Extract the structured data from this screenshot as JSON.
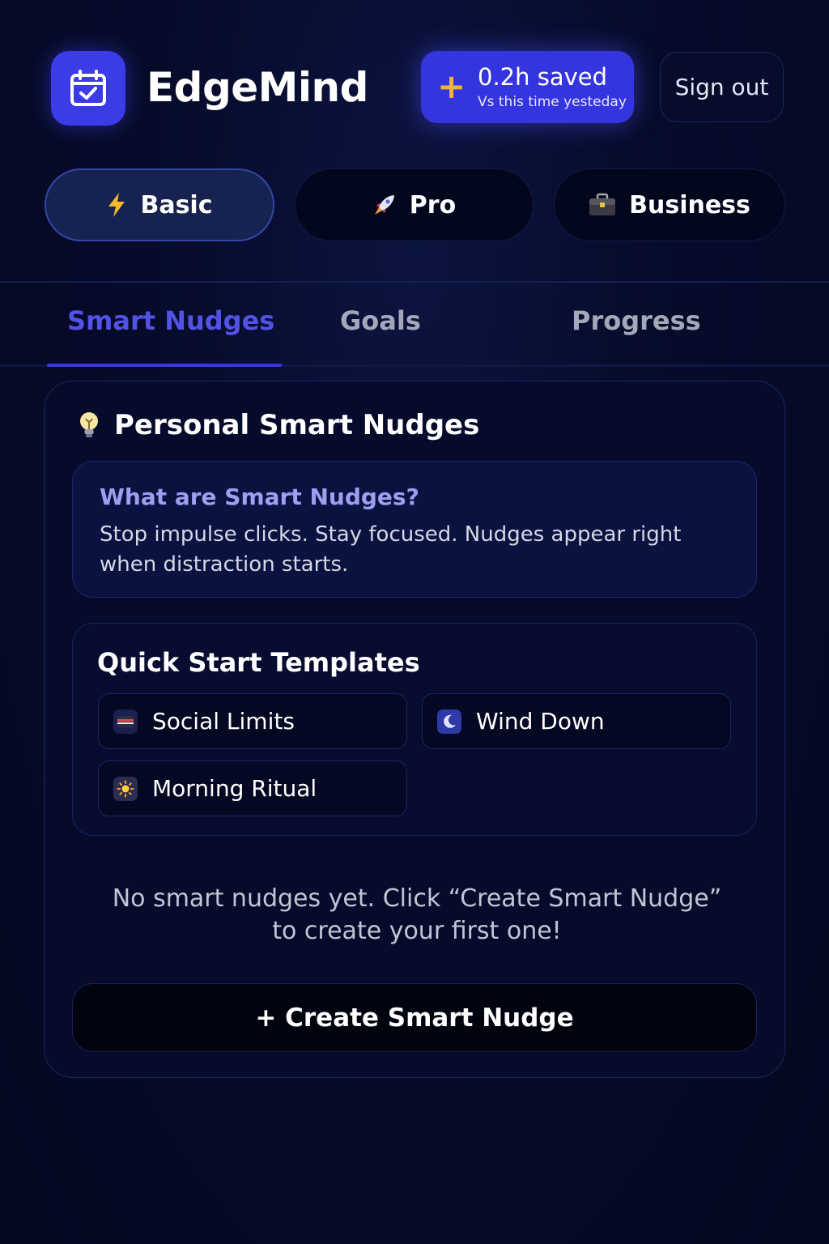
{
  "header": {
    "app_name": "EdgeMind",
    "saved_badge": {
      "icon": "plus-icon",
      "value": "0.2h saved",
      "subtitle": "Vs this time yesteday",
      "accent": "#f0b43a"
    },
    "sign_out_label": "Sign out"
  },
  "plans": [
    {
      "label": "Basic",
      "icon": "lightning-icon",
      "active": true
    },
    {
      "label": "Pro",
      "icon": "rocket-icon",
      "active": false
    },
    {
      "label": "Business",
      "icon": "briefcase-icon",
      "active": false
    }
  ],
  "tabs": [
    {
      "label": "Smart Nudges",
      "active": true
    },
    {
      "label": "Goals",
      "active": false
    },
    {
      "label": "Progress",
      "active": false
    }
  ],
  "main": {
    "section_title": "Personal Smart Nudges",
    "section_icon": "lightbulb-icon",
    "info": {
      "title": "What are Smart Nudges?",
      "text": "Stop impulse clicks. Stay focused. Nudges appear right when distraction starts."
    },
    "templates": {
      "title": "Quick Start Templates",
      "items": [
        {
          "label": "Social Limits",
          "icon": "phone-icon"
        },
        {
          "label": "Wind Down",
          "icon": "moon-icon"
        },
        {
          "label": "Morning Ritual",
          "icon": "sun-icon"
        }
      ]
    },
    "empty_message": "No smart nudges yet. Click “Create Smart Nudge” to create your first one!",
    "create_button_label": "+ Create Smart Nudge"
  },
  "colors": {
    "accent": "#3b3be8",
    "active_tab": "#5252e6",
    "background": "#050a24"
  }
}
